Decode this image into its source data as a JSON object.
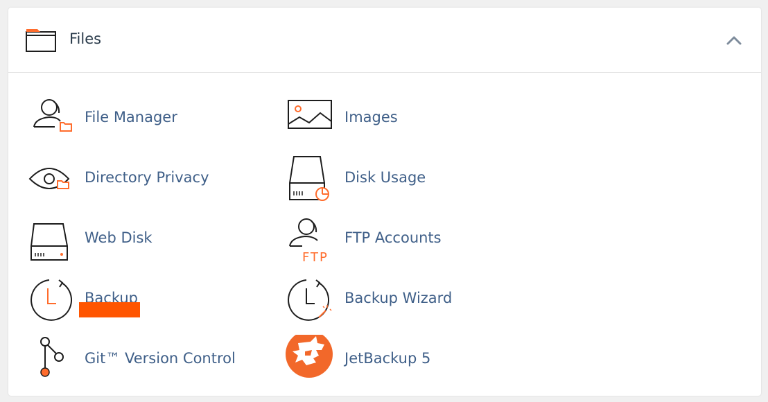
{
  "section": {
    "title": "Files",
    "icon": "folder-icon",
    "chevron": "chevron-up-icon"
  },
  "accent_color": "#ff6c2c",
  "link_color": "#3f5f88",
  "items": [
    {
      "label": "File Manager",
      "icon": "file-manager-icon"
    },
    {
      "label": "Images",
      "icon": "images-icon"
    },
    {
      "label": "Directory Privacy",
      "icon": "directory-privacy-icon"
    },
    {
      "label": "Disk Usage",
      "icon": "disk-usage-icon"
    },
    {
      "label": "Web Disk",
      "icon": "web-disk-icon"
    },
    {
      "label": "FTP Accounts",
      "icon": "ftp-accounts-icon"
    },
    {
      "label": "Backup",
      "icon": "backup-icon"
    },
    {
      "label": "Backup Wizard",
      "icon": "backup-wizard-icon"
    },
    {
      "label": "Git™ Version Control",
      "icon": "git-icon"
    },
    {
      "label": "JetBackup 5",
      "icon": "jetbackup-icon"
    }
  ],
  "ftp_icon_text": "FTP"
}
